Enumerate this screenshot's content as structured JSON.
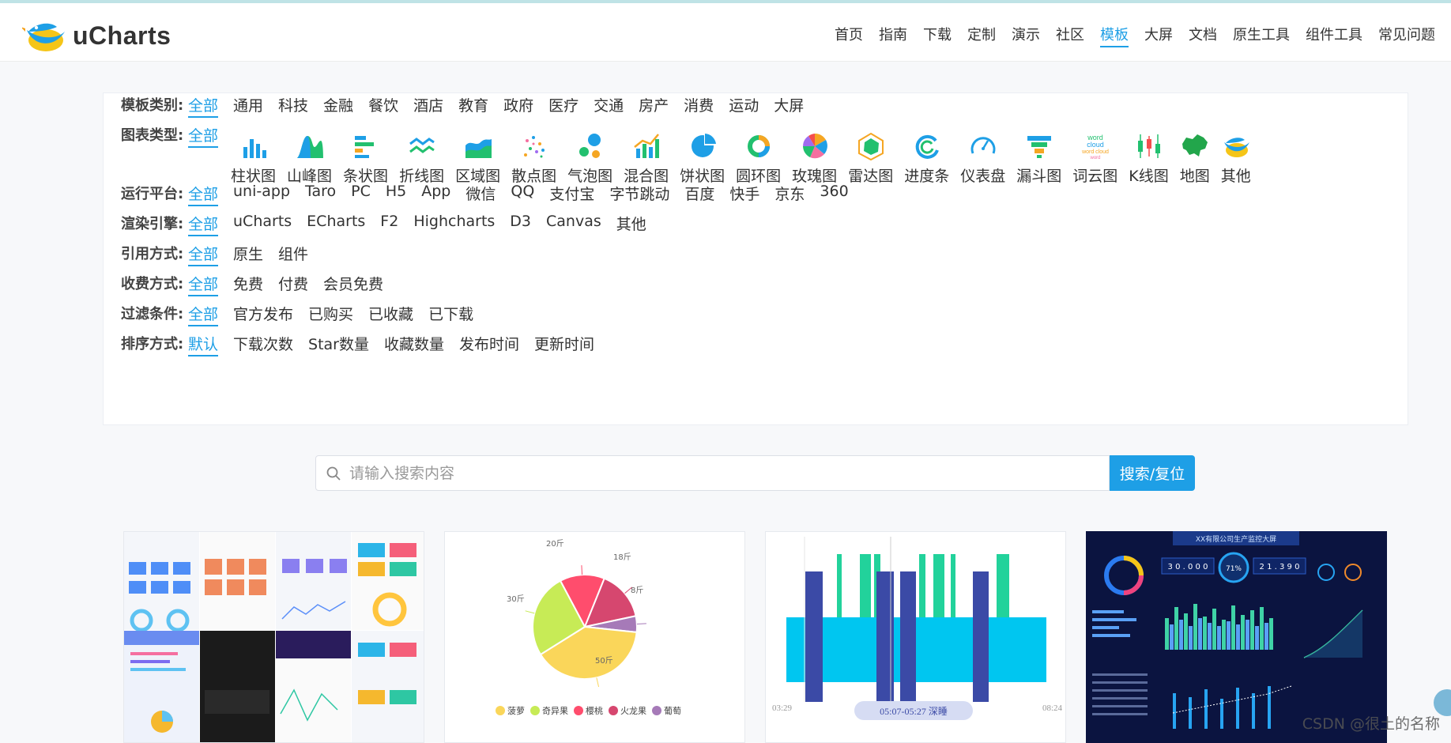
{
  "app": {
    "logo_text": "uCharts"
  },
  "nav": [
    "首页",
    "指南",
    "下载",
    "定制",
    "演示",
    "社区",
    "模板",
    "大屏",
    "文档",
    "原生工具",
    "组件工具",
    "常见问题"
  ],
  "nav_active": "模板",
  "filters": {
    "template_category": {
      "label": "模板类别:",
      "options": [
        "全部",
        "通用",
        "科技",
        "金融",
        "餐饮",
        "酒店",
        "教育",
        "政府",
        "医疗",
        "交通",
        "房产",
        "消费",
        "运动",
        "大屏"
      ]
    },
    "chart_type": {
      "label": "图表类型:",
      "all": "全部",
      "types": [
        {
          "label": "柱状图",
          "icon": "bar-chart-icon"
        },
        {
          "label": "山峰图",
          "icon": "mountain-chart-icon"
        },
        {
          "label": "条状图",
          "icon": "horizontal-bar-icon"
        },
        {
          "label": "折线图",
          "icon": "line-chart-icon"
        },
        {
          "label": "区域图",
          "icon": "area-chart-icon"
        },
        {
          "label": "散点图",
          "icon": "scatter-chart-icon"
        },
        {
          "label": "气泡图",
          "icon": "bubble-chart-icon"
        },
        {
          "label": "混合图",
          "icon": "mixed-chart-icon"
        },
        {
          "label": "饼状图",
          "icon": "pie-chart-icon"
        },
        {
          "label": "圆环图",
          "icon": "ring-chart-icon"
        },
        {
          "label": "玫瑰图",
          "icon": "rose-chart-icon"
        },
        {
          "label": "雷达图",
          "icon": "radar-chart-icon"
        },
        {
          "label": "进度条",
          "icon": "progress-arc-icon"
        },
        {
          "label": "仪表盘",
          "icon": "gauge-icon"
        },
        {
          "label": "漏斗图",
          "icon": "funnel-chart-icon"
        },
        {
          "label": "词云图",
          "icon": "word-cloud-icon"
        },
        {
          "label": "K线图",
          "icon": "candlestick-icon"
        },
        {
          "label": "地图",
          "icon": "china-map-icon"
        },
        {
          "label": "其他",
          "icon": "bird-logo-icon"
        }
      ],
      "word_cloud_icon_text": [
        "word",
        "cloud",
        "word cloud",
        "word"
      ]
    },
    "platform": {
      "label": "运行平台:",
      "options": [
        "全部",
        "uni-app",
        "Taro",
        "PC",
        "H5",
        "App",
        "微信",
        "QQ",
        "支付宝",
        "字节跳动",
        "百度",
        "快手",
        "京东",
        "360"
      ]
    },
    "engine": {
      "label": "渲染引擎:",
      "options": [
        "全部",
        "uCharts",
        "ECharts",
        "F2",
        "Highcharts",
        "D3",
        "Canvas",
        "其他"
      ]
    },
    "reference": {
      "label": "引用方式:",
      "options": [
        "全部",
        "原生",
        "组件"
      ]
    },
    "fee": {
      "label": "收费方式:",
      "options": [
        "全部",
        "免费",
        "付费",
        "会员免费"
      ]
    },
    "filter_cond": {
      "label": "过滤条件:",
      "options": [
        "全部",
        "官方发布",
        "已购买",
        "已收藏",
        "已下载"
      ]
    },
    "sort": {
      "label": "排序方式:",
      "options": [
        "默认",
        "下载次数",
        "Star数量",
        "收藏数量",
        "发布时间",
        "更新时间"
      ]
    }
  },
  "search": {
    "placeholder": "请输入搜索内容",
    "button": "搜索/复位"
  },
  "cards": {
    "pie": {
      "labels": [
        "20斤",
        "18斤",
        "8斤",
        "50斤",
        "30斤"
      ],
      "legend": [
        "菠萝",
        "奇异果",
        "樱桃",
        "火龙果",
        "葡萄"
      ],
      "colors": [
        "#ff4d6d",
        "#d6476f",
        "#a67ab8",
        "#fad65a",
        "#c7eb56"
      ]
    },
    "sleep": {
      "start": "03:29",
      "end": "08:24",
      "badge": "05:07-05:27 深睡"
    },
    "dashboard": {
      "title": "XX有限公司生产监控大屏",
      "counter_a": "3 0 . 0 0 0",
      "counter_b": "2 1 . 3 9 0",
      "gauge": "71%"
    }
  },
  "watermark": "CSDN @很土的名称",
  "colors": {
    "accent": "#1e9fe6"
  }
}
